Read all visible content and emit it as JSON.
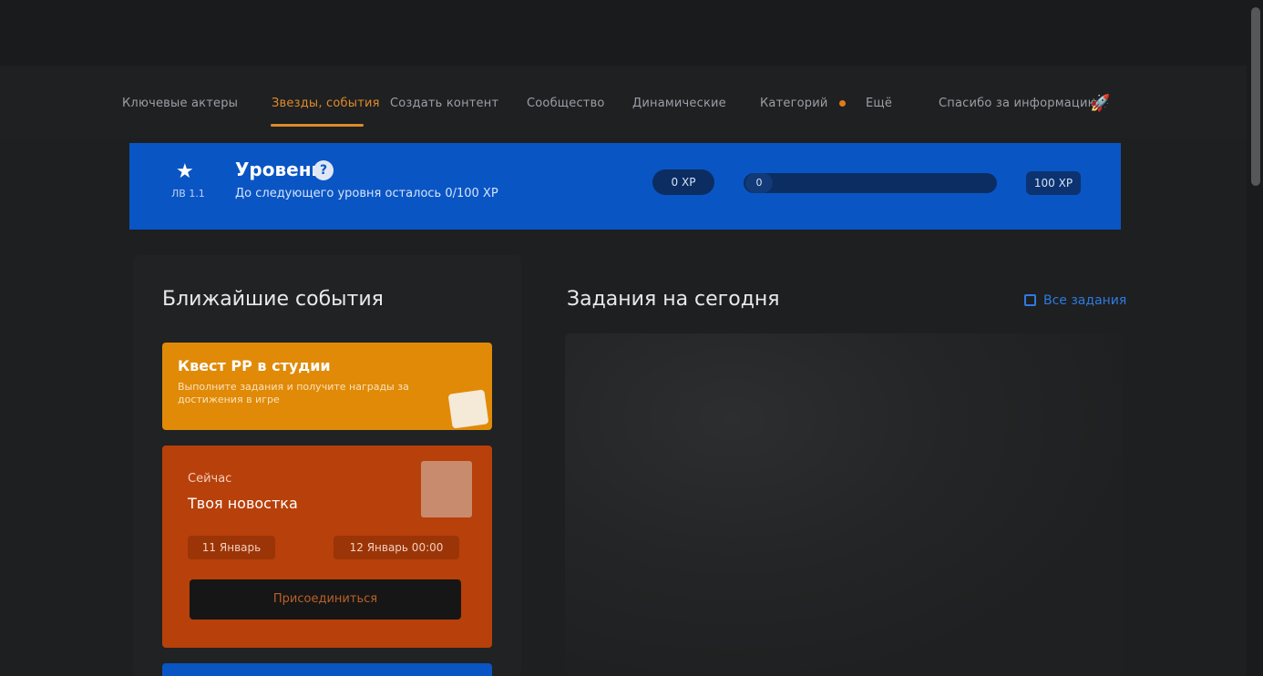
{
  "nav": {
    "items": [
      {
        "label": "Ключевые актеры"
      },
      {
        "label": "Звезды, события"
      },
      {
        "label": "Создать контент"
      },
      {
        "label": "Сообщество"
      },
      {
        "label": "Динамические"
      },
      {
        "label": "Категорий"
      },
      {
        "label": "Ещё"
      },
      {
        "label": "Спасибо за информацию"
      }
    ],
    "active_index": 1
  },
  "banner": {
    "level_sub": "ЛВ 1.1",
    "title": "Уровень",
    "help": "?",
    "description": "До следующего уровня осталось 0/100 XP",
    "pill": "0 XP",
    "progress": 0.0,
    "knob_label": "0",
    "end_label": "100 XP"
  },
  "left": {
    "heading": "Ближайшие события",
    "card1": {
      "title": "Квест РР в студии",
      "description": "Выполните задания и получите награды за достижения в игре"
    },
    "card2": {
      "small": "Сейчас",
      "title": "Твоя новостка",
      "chip1": "11 Январь",
      "chip2": "12 Январь 00:00",
      "button": "Присоединиться"
    }
  },
  "right": {
    "heading": "Задания на сегодня",
    "all_link": "Все задания"
  },
  "colors": {
    "accent_orange": "#e08a2a",
    "banner_blue": "#0a55c4",
    "card_yellow": "#e08a08",
    "card_red": "#b8400a"
  }
}
